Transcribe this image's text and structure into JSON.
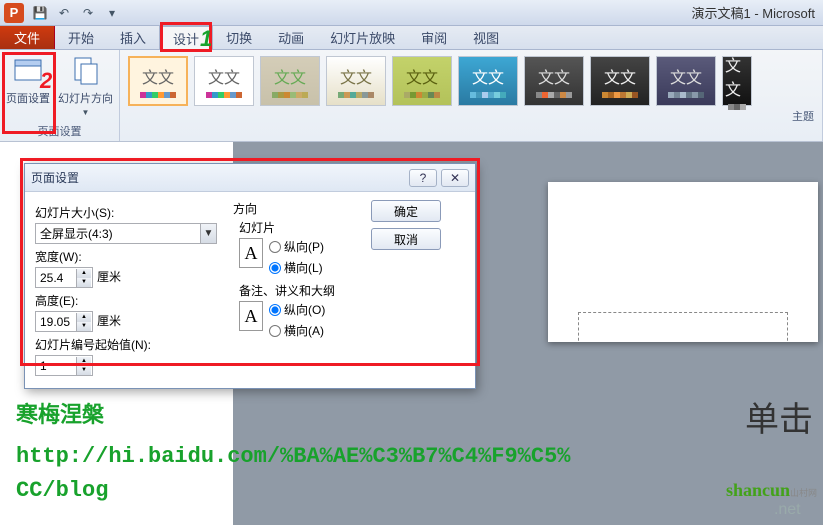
{
  "titlebar": {
    "doc_title": "演示文稿1 - Microsoft"
  },
  "tabs": {
    "file": "文件",
    "home": "开始",
    "insert": "插入",
    "design": "设计",
    "transition": "切换",
    "animation": "动画",
    "slideshow": "幻灯片放映",
    "review": "审阅",
    "view": "视图"
  },
  "ribbon": {
    "page_setup": "页面设置",
    "page_setup_btn": "页面设置",
    "orientation_btn": "幻灯片方向",
    "themes_label": "主题",
    "theme_text": "文文"
  },
  "callouts": {
    "one": "1",
    "two": "2"
  },
  "dialog": {
    "title": "页面设置",
    "slide_size_label": "幻灯片大小(S):",
    "slide_size_value": "全屏显示(4:3)",
    "width_label": "宽度(W):",
    "width_value": "25.4",
    "height_label": "高度(E):",
    "height_value": "19.05",
    "unit": "厘米",
    "number_label": "幻灯片编号起始值(N):",
    "number_value": "1",
    "orientation_title": "方向",
    "slides_group": "幻灯片",
    "portrait_p": "纵向(P)",
    "landscape_l": "横向(L)",
    "notes_group": "备注、讲义和大纲",
    "portrait_o": "纵向(O)",
    "landscape_a": "横向(A)",
    "ok": "确定",
    "cancel": "取消",
    "icon_letter": "A"
  },
  "slide": {
    "placeholder_text": "单击"
  },
  "overlay": {
    "line1": "寒梅涅槃",
    "line2": "http://hi.baidu.com/%BA%AE%C3%B7%C4%F9%C5%",
    "line3": "CC/blog"
  },
  "watermark": {
    "brand": "shancun",
    "tld": ".net",
    "zh": "山村网"
  }
}
